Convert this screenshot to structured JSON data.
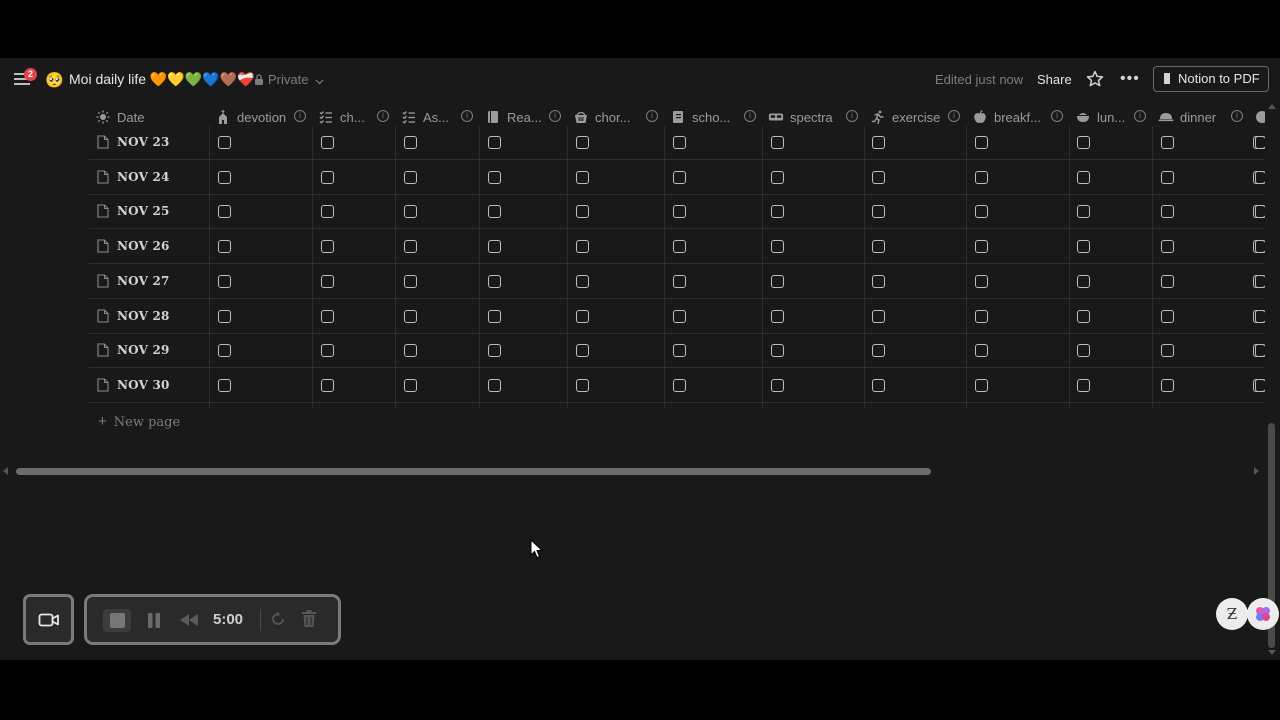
{
  "topbar": {
    "notification_count": "2",
    "page_emoji": "🥺",
    "title": "Moi daily life 🧡💛💚💙🤎❤️‍🩹",
    "privacy": "Private",
    "edited": "Edited just now",
    "share": "Share",
    "notion_to_pdf": "Notion to PDF"
  },
  "table": {
    "columns": [
      {
        "label": "Date",
        "icon": "sun-icon"
      },
      {
        "label": "devotion",
        "icon": "church-icon"
      },
      {
        "label": "ch...",
        "icon": "checklist-icon"
      },
      {
        "label": "As...",
        "icon": "checklist-icon"
      },
      {
        "label": "Rea...",
        "icon": "book-icon"
      },
      {
        "label": "chor...",
        "icon": "basket-icon"
      },
      {
        "label": "scho...",
        "icon": "notebook-icon"
      },
      {
        "label": "spectra",
        "icon": "vr-headset-icon"
      },
      {
        "label": "exercise",
        "icon": "running-icon"
      },
      {
        "label": "breakf...",
        "icon": "apple-icon"
      },
      {
        "label": "lun...",
        "icon": "bowl-icon"
      },
      {
        "label": "dinner",
        "icon": "dish-icon"
      }
    ],
    "rows": [
      {
        "date": "NOV 23"
      },
      {
        "date": "NOV 24"
      },
      {
        "date": "NOV 25"
      },
      {
        "date": "NOV 26"
      },
      {
        "date": "NOV 27"
      },
      {
        "date": "NOV 28"
      },
      {
        "date": "NOV 29"
      },
      {
        "date": "NOV 30"
      }
    ],
    "new_page": "New page"
  },
  "recorder": {
    "time": "5:00"
  },
  "colors": {
    "background": "#191919",
    "text": "#d4d4d4",
    "muted": "#7d7d7d",
    "badge": "#e0454b"
  }
}
